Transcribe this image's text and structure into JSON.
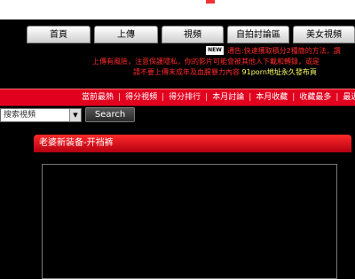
{
  "nav": {
    "items": [
      {
        "label": "首頁"
      },
      {
        "label": "上傳"
      },
      {
        "label": "視頻"
      },
      {
        "label": "自拍討論區"
      },
      {
        "label": "美女視頻"
      }
    ]
  },
  "notice": {
    "new_badge": "NEW",
    "line1": "通告:快速獲取積分2種簡的方法，讚",
    "line2": "上傳有風險，注意保護隱私，你的影片可能會被其他人下載和轉錄，或是",
    "line3": "請不要上傳未成年及血腥暴力內容",
    "line3_highlight": "91porn地址永久發布頁"
  },
  "redbar": {
    "links": [
      "當前最熱",
      "得分視頻",
      "得分排行",
      "本月討論",
      "本月收藏",
      "收藏最多",
      "最近"
    ]
  },
  "search": {
    "select_value": "搜索視頻",
    "button_label": "Search"
  },
  "panel": {
    "title": "老婆新装备-开裆裤"
  },
  "colors": {
    "accent_red": "#e1001e",
    "notice_red": "#ff2a2a",
    "background": "#000000"
  }
}
